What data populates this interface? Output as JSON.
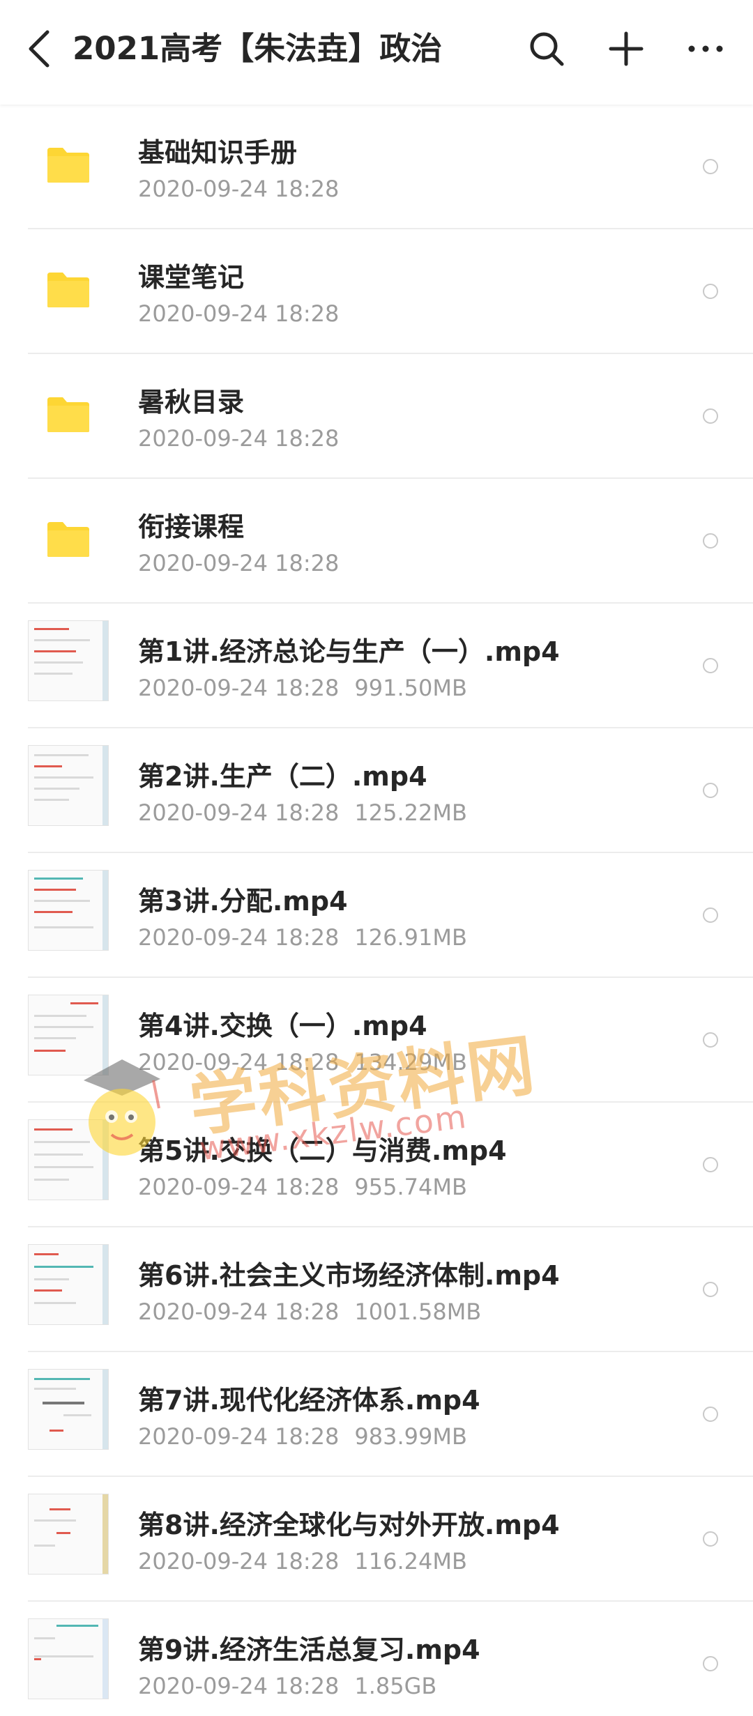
{
  "header": {
    "title": "2021高考【朱法垚】政治",
    "icons": [
      "back-arrow-icon",
      "search-icon",
      "add-icon",
      "more-icon"
    ]
  },
  "items": [
    {
      "type": "folder",
      "name": "基础知识手册",
      "date": "2020-09-24  18:28",
      "size": ""
    },
    {
      "type": "folder",
      "name": "课堂笔记",
      "date": "2020-09-24  18:28",
      "size": ""
    },
    {
      "type": "folder",
      "name": "暑秋目录",
      "date": "2020-09-24  18:28",
      "size": ""
    },
    {
      "type": "folder",
      "name": "衔接课程",
      "date": "2020-09-24  18:28",
      "size": ""
    },
    {
      "type": "video",
      "name": "第1讲.经济总论与生产（一）.mp4",
      "date": "2020-09-24  18:28",
      "size": "991.50MB"
    },
    {
      "type": "video",
      "name": "第2讲.生产（二）.mp4",
      "date": "2020-09-24  18:28",
      "size": "125.22MB"
    },
    {
      "type": "video",
      "name": "第3讲.分配.mp4",
      "date": "2020-09-24  18:28",
      "size": "126.91MB"
    },
    {
      "type": "video",
      "name": "第4讲.交换（一）.mp4",
      "date": "2020-09-24  18:28",
      "size": "134.29MB"
    },
    {
      "type": "video",
      "name": "第5讲.交换（二）与消费.mp4",
      "date": "2020-09-24  18:28",
      "size": "955.74MB"
    },
    {
      "type": "video",
      "name": "第6讲.社会主义市场经济体制.mp4",
      "date": "2020-09-24  18:28",
      "size": "1001.58MB"
    },
    {
      "type": "video",
      "name": "第7讲.现代化经济体系.mp4",
      "date": "2020-09-24  18:28",
      "size": "983.99MB"
    },
    {
      "type": "video",
      "name": "第8讲.经济全球化与对外开放.mp4",
      "date": "2020-09-24  18:28",
      "size": "116.24MB"
    },
    {
      "type": "video",
      "name": "第9讲.经济生活总复习.mp4",
      "date": "2020-09-24  18:28",
      "size": "1.85GB"
    }
  ],
  "watermark": {
    "text": "学科资料网",
    "url": "www.xkzlw.com"
  },
  "colors": {
    "folder": "#FDD634",
    "title_text": "#262626",
    "meta_text": "#9B9B9B",
    "divider": "#ECECEC"
  }
}
